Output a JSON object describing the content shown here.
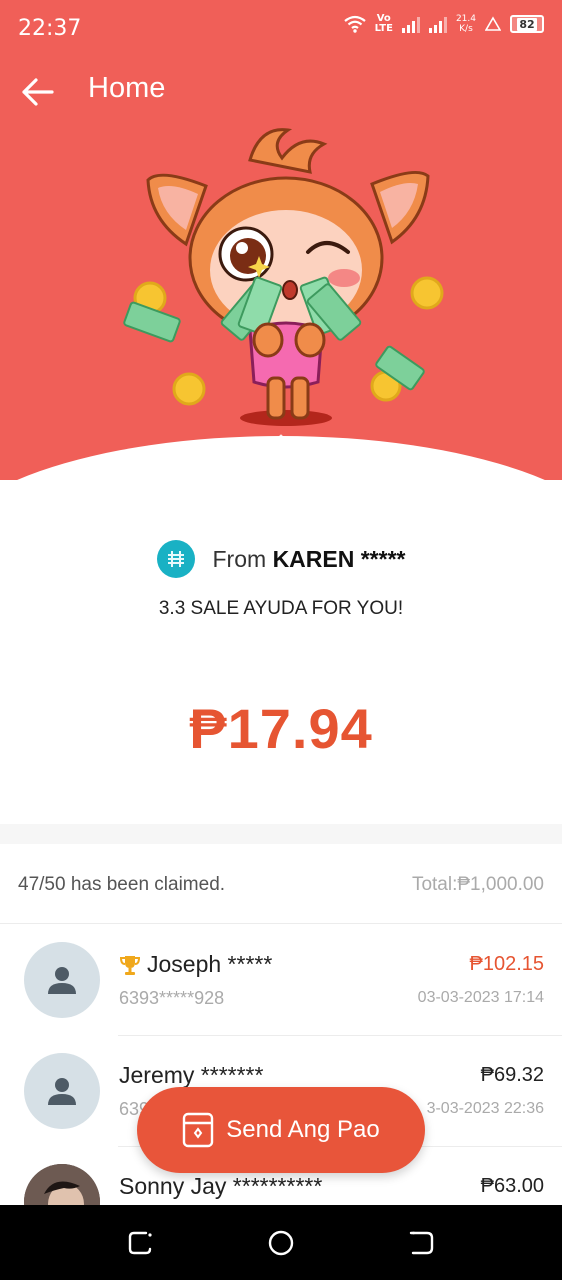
{
  "status": {
    "time": "22:37",
    "volte": "Vo\nLTE",
    "net_speed": "21.4\nK/s",
    "battery": "82"
  },
  "appbar": {
    "title": "Home"
  },
  "sender": {
    "prefix": "From",
    "name": "KAREN *****",
    "message": "3.3 SALE AYUDA FOR YOU!",
    "amount": "₱17.94"
  },
  "claims": {
    "claimed_text": "47/50 has been claimed.",
    "total_text": "Total:₱1,000.00"
  },
  "claimants": [
    {
      "name": "Joseph *****",
      "phone": "6393*****928",
      "amount": "₱102.15",
      "date": "03-03-2023 17:14",
      "best": true
    },
    {
      "name": "Jeremy *******",
      "phone": "639",
      "amount": "₱69.32",
      "date": "3-03-2023 22:36",
      "best": false
    },
    {
      "name": "Sonny Jay **********",
      "phone": "",
      "amount": "₱63.00",
      "date": "",
      "best": false
    }
  ],
  "send_button": {
    "label": "Send Ang Pao"
  },
  "colors": {
    "hero": "#f05f58",
    "accent": "#e65532",
    "button": "#e8553a"
  },
  "icons": [
    "back-arrow-icon",
    "trophy-icon",
    "default-avatar-icon",
    "ang-pao-icon",
    "recent-apps-icon",
    "home-icon",
    "back-icon"
  ]
}
